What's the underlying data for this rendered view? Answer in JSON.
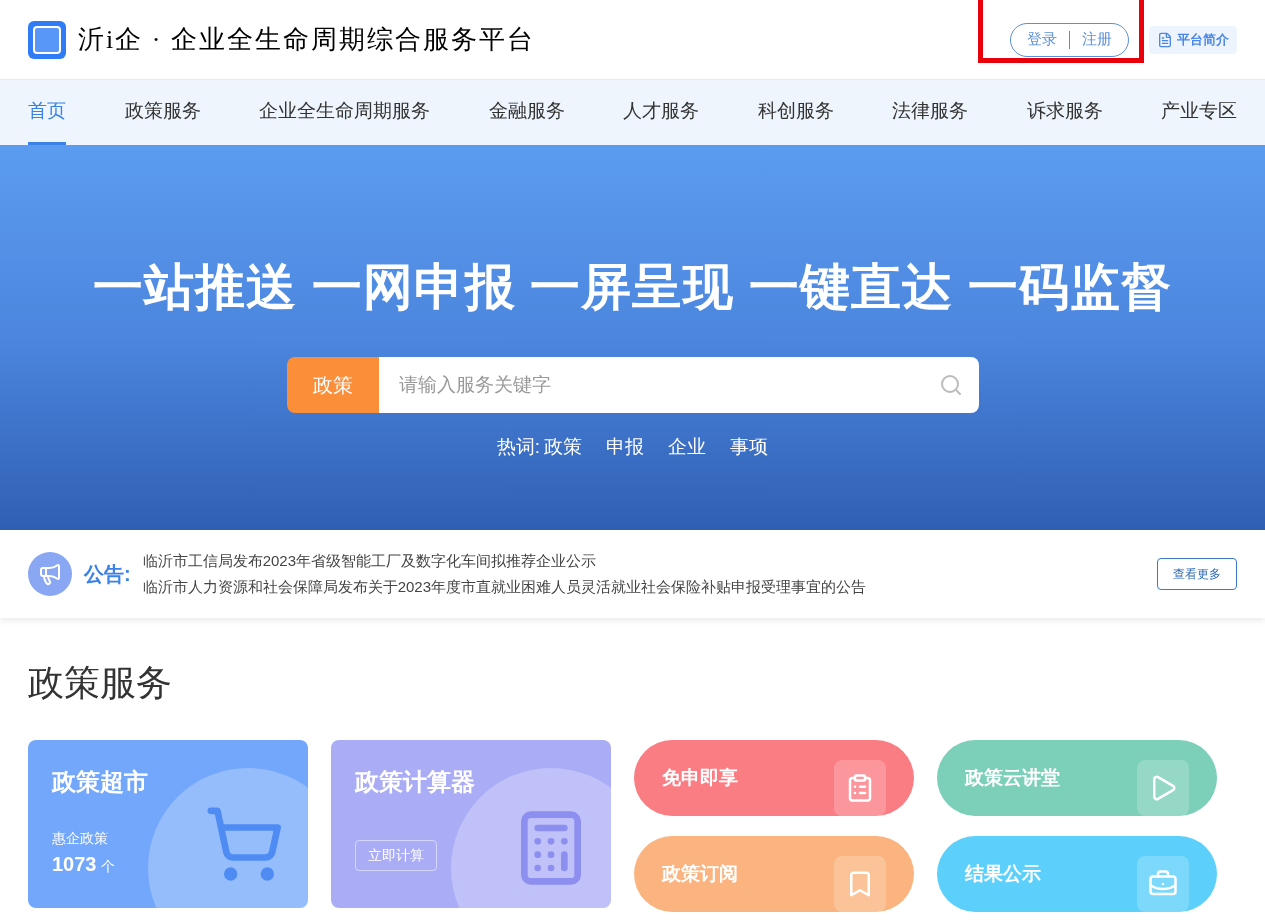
{
  "header": {
    "logo_text": "沂i企 · 企业全生命周期综合服务平台",
    "login": "登录",
    "register": "注册",
    "intro": "平台简介",
    "highlighted": true
  },
  "nav": [
    {
      "label": "首页",
      "selected": true
    },
    {
      "label": "政策服务",
      "selected": false
    },
    {
      "label": "企业全生命周期服务",
      "selected": false
    },
    {
      "label": "金融服务",
      "selected": false
    },
    {
      "label": "人才服务",
      "selected": false
    },
    {
      "label": "科创服务",
      "selected": false
    },
    {
      "label": "法律服务",
      "selected": false
    },
    {
      "label": "诉求服务",
      "selected": false
    },
    {
      "label": "产业专区",
      "selected": false
    }
  ],
  "hero": {
    "slogan": "一站推送 一网申报 一屏呈现 一键直达 一码监督",
    "search_category": "政策",
    "placeholder": "请输入服务关键字",
    "hot_label": "热词:",
    "hot_words": [
      "政策",
      "申报",
      "企业",
      "事项"
    ]
  },
  "notice": {
    "label": "公告:",
    "items": [
      "临沂市工信局发布2023年省级智能工厂及数字化车间拟推荐企业公示",
      "临沂市人力资源和社会保障局发布关于2023年度市直就业困难人员灵活就业社会保险补贴申报受理事宜的公告"
    ],
    "more": "查看更多"
  },
  "policy_section": {
    "title": "政策服务",
    "cards": [
      {
        "kind": "market",
        "title": "政策超市",
        "caption": "惠企政策",
        "count": "1073",
        "unit": "个"
      },
      {
        "kind": "calculator",
        "title": "政策计算器",
        "button": "立即计算"
      }
    ],
    "pills": [
      {
        "title": "免申即享",
        "color": "#fb7d84",
        "kind": "clipboard"
      },
      {
        "title": "政策云讲堂",
        "color": "#7ccfb8",
        "kind": "play"
      },
      {
        "title": "政策订阅",
        "color": "#fbb47f",
        "kind": "bookmark"
      },
      {
        "title": "结果公示",
        "color": "#5cd0fb",
        "kind": "briefcase"
      }
    ]
  }
}
